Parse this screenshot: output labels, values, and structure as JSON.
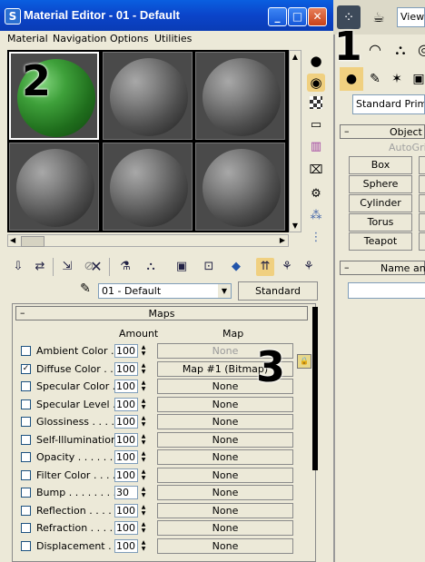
{
  "window": {
    "title": "Material Editor - 01 - Default",
    "app_glyph": "S",
    "minimize": "_",
    "maximize": "□",
    "close": "✕"
  },
  "menu": [
    "Material",
    "Navigation",
    "Options",
    "Utilities"
  ],
  "overlays": {
    "one": "1",
    "two": "2",
    "three": "3"
  },
  "material": {
    "name": "01 - Default",
    "type": "Standard"
  },
  "maps": {
    "title": "Maps",
    "collapse": "–",
    "col_amount": "Amount",
    "col_map": "Map",
    "rows": [
      {
        "label": "Ambient Color . .",
        "checked": false,
        "amount": "100",
        "map": "None",
        "disabled": true
      },
      {
        "label": "Diffuse Color . . .",
        "checked": true,
        "amount": "100",
        "map": "Map #1 (Bitmap)",
        "disabled": false
      },
      {
        "label": "Specular Color .",
        "checked": false,
        "amount": "100",
        "map": "None",
        "disabled": false
      },
      {
        "label": "Specular Level .",
        "checked": false,
        "amount": "100",
        "map": "None",
        "disabled": false
      },
      {
        "label": "Glossiness . . . . .",
        "checked": false,
        "amount": "100",
        "map": "None",
        "disabled": false
      },
      {
        "label": "Self-Illumination .",
        "checked": false,
        "amount": "100",
        "map": "None",
        "disabled": false
      },
      {
        "label": "Opacity . . . . . . .",
        "checked": false,
        "amount": "100",
        "map": "None",
        "disabled": false
      },
      {
        "label": "Filter Color . . . . .",
        "checked": false,
        "amount": "100",
        "map": "None",
        "disabled": false
      },
      {
        "label": "Bump . . . . . . . . .",
        "checked": false,
        "amount": "30",
        "map": "None",
        "disabled": false
      },
      {
        "label": "Reflection . . . . .",
        "checked": false,
        "amount": "100",
        "map": "None",
        "disabled": false
      },
      {
        "label": "Refraction . . . . .",
        "checked": false,
        "amount": "100",
        "map": "None",
        "disabled": false
      },
      {
        "label": "Displacement . .",
        "checked": false,
        "amount": "100",
        "map": "None",
        "disabled": false
      }
    ]
  },
  "command_panel": {
    "view_label": "View",
    "primitive_dropdown": "Standard Primitive",
    "object_type_header": "Object T",
    "autogrid": "AutoGri",
    "object_buttons": [
      "Box",
      "Sphere",
      "Cylinder",
      "Torus",
      "Teapot"
    ],
    "name_header": "Name and",
    "collapse": "–"
  }
}
